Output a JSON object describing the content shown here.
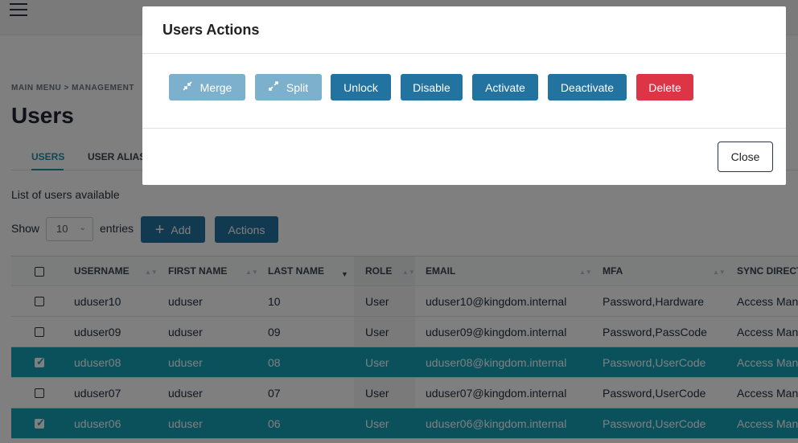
{
  "breadcrumb": "MAIN MENU > MANAGEMENT",
  "page_title": "Users",
  "tabs": [
    {
      "label": "USERS",
      "active": true
    },
    {
      "label": "USER ALIAS",
      "active": false
    }
  ],
  "list_description": "List of users available",
  "controls": {
    "show_label": "Show",
    "entries_value": "10",
    "entries_label": "entries",
    "add_label": "Add",
    "actions_label": "Actions"
  },
  "table": {
    "columns": [
      "USERNAME",
      "FIRST NAME",
      "LAST NAME",
      "ROLE",
      "EMAIL",
      "MFA",
      "SYNC DIRECT"
    ],
    "rows": [
      {
        "selected": false,
        "cells": [
          "uduser10",
          "uduser",
          "10",
          "User",
          "uduser10@kingdom.internal",
          "Password,Hardware",
          "Access Man"
        ]
      },
      {
        "selected": false,
        "cells": [
          "uduser09",
          "uduser",
          "09",
          "User",
          "uduser09@kingdom.internal",
          "Password,PassCode",
          "Access Man"
        ]
      },
      {
        "selected": true,
        "cells": [
          "uduser08",
          "uduser",
          "08",
          "User",
          "uduser08@kingdom.internal",
          "Password,UserCode",
          "Access Man"
        ]
      },
      {
        "selected": false,
        "cells": [
          "uduser07",
          "uduser",
          "07",
          "User",
          "uduser07@kingdom.internal",
          "Password,UserCode",
          "Access Man"
        ]
      },
      {
        "selected": true,
        "cells": [
          "uduser06",
          "uduser",
          "06",
          "User",
          "uduser06@kingdom.internal",
          "Password,UserCode",
          "Access Man"
        ]
      }
    ]
  },
  "modal": {
    "title": "Users Actions",
    "buttons": {
      "merge": "Merge",
      "split": "Split",
      "unlock": "Unlock",
      "disable": "Disable",
      "activate": "Activate",
      "deactivate": "Deactivate",
      "delete": "Delete"
    },
    "close_label": "Close"
  },
  "colors": {
    "primary": "#2273a0",
    "primary_disabled": "#7db0cc",
    "danger": "#dc3545",
    "selected_row": "#17a2b8"
  },
  "icons": {
    "merge": "compress-arrows-icon",
    "split": "expand-arrows-icon",
    "menu": "hamburger-menu-icon",
    "add": "plus-icon"
  }
}
